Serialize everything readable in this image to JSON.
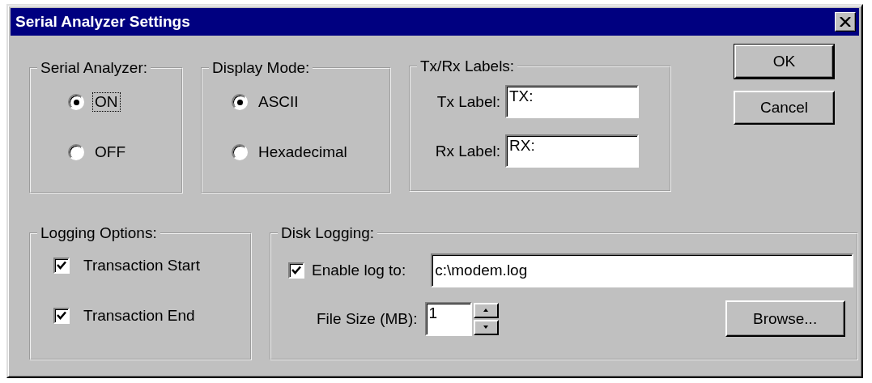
{
  "window": {
    "title": "Serial Analyzer Settings"
  },
  "serial_analyzer": {
    "label": "Serial Analyzer:",
    "options": [
      {
        "label": "ON",
        "selected": true,
        "focused": true
      },
      {
        "label": "OFF",
        "selected": false,
        "focused": false
      }
    ]
  },
  "display_mode": {
    "label": "Display Mode:",
    "options": [
      {
        "label": "ASCII",
        "selected": true,
        "focused": false
      },
      {
        "label": "Hexadecimal",
        "selected": false,
        "focused": false
      }
    ]
  },
  "tx_rx_labels": {
    "label": "Tx/Rx Labels:",
    "fields": [
      {
        "label": "Tx Label:",
        "value": "TX:"
      },
      {
        "label": "Rx Label:",
        "value": "RX:"
      }
    ]
  },
  "buttons": [
    {
      "label": "OK",
      "default": true
    },
    {
      "label": "Cancel",
      "default": false
    }
  ],
  "logging_options": {
    "label": "Logging Options:",
    "options": [
      {
        "label": "Transaction Start",
        "checked": true
      },
      {
        "label": "Transaction End",
        "checked": true
      }
    ]
  },
  "disk_logging": {
    "label": "Disk Logging:",
    "enable": {
      "label": "Enable log to:",
      "checked": true
    },
    "path": {
      "value": "c:\\modem.log"
    },
    "file_size": {
      "label": "File Size (MB):",
      "value": "1"
    },
    "browse_button": {
      "label": "Browse..."
    }
  }
}
